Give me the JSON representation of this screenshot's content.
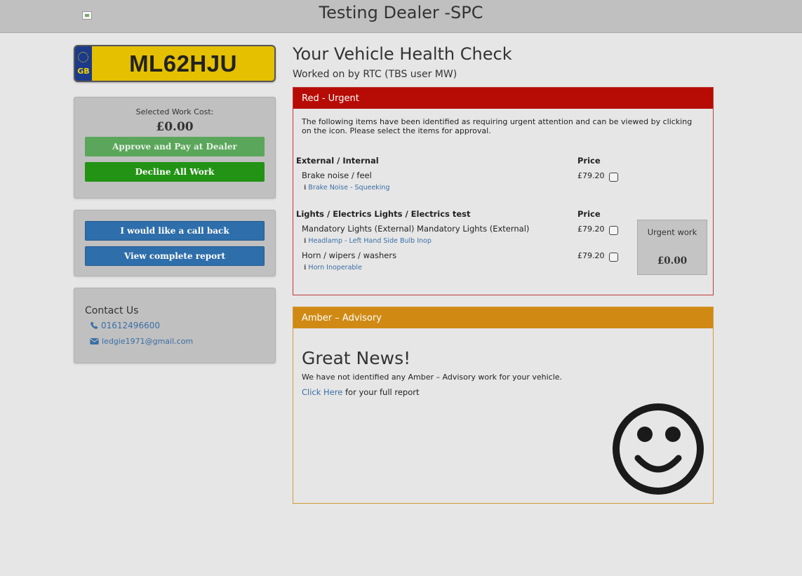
{
  "header": {
    "dealer_title": "Testing Dealer -SPC"
  },
  "vehicle": {
    "plate_country": "GB",
    "registration": "ML62HJU"
  },
  "cost_card": {
    "label": "Selected Work Cost:",
    "value": "£0.00",
    "approve_button": "Approve and Pay at Dealer",
    "decline_button": "Decline All Work"
  },
  "actions": {
    "callback_button": "I would like a call back",
    "report_button": "View complete report"
  },
  "contact": {
    "title": "Contact Us",
    "phone": "01612496600",
    "email": "ledgie1971@gmail.com",
    "phone_icon": "phone-icon",
    "email_icon": "envelope-icon"
  },
  "main": {
    "title": "Your Vehicle Health Check",
    "worked_on": "Worked on by RTC (TBS user MW)"
  },
  "red_panel": {
    "heading": "Red - Urgent",
    "color": "#b60c05",
    "intro": "The following items have been identified as requiring urgent attention and can be viewed by clicking on the icon. Please select the items for approval.",
    "sections": [
      {
        "title": "External / Internal",
        "price_label": "Price",
        "items": [
          {
            "name": "Brake noise / feel",
            "price": "£79.20",
            "link": "Brake Noise - Squeeking",
            "checked": false
          }
        ]
      },
      {
        "title": "Lights / Electrics Lights / Electrics test",
        "price_label": "Price",
        "items": [
          {
            "name": "Mandatory Lights (External) Mandatory Lights (External)",
            "price": "£79.20",
            "link": "Headlamp - Left Hand Side Bulb Inop",
            "checked": false
          },
          {
            "name": "Horn / wipers / washers",
            "price": "£79.20",
            "link": "Horn Inoperable",
            "checked": false
          }
        ]
      }
    ],
    "urgent_box": {
      "label": "Urgent work",
      "value": "£0.00"
    }
  },
  "amber_panel": {
    "heading": "Amber – Advisory",
    "color": "#d08a14",
    "great_news": "Great News!",
    "message": "We have not identified any Amber – Advisory work for your vehicle.",
    "link_text": "Click Here",
    "link_suffix": " for your full report",
    "icon": "smiley-face-icon"
  }
}
